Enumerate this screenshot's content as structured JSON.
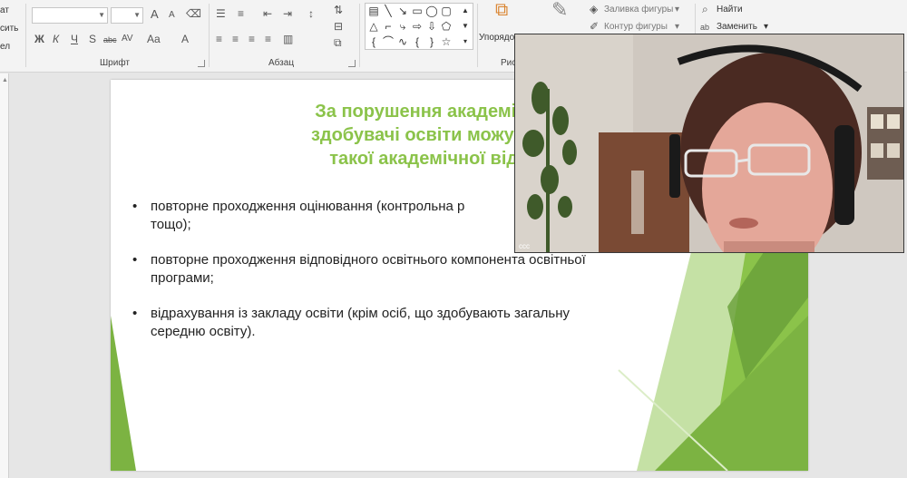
{
  "ribbon": {
    "left_edge": [
      "ат",
      "сить",
      "ел"
    ],
    "font_group_label": "Шрифт",
    "paragraph_group_label": "Абзац",
    "drawing_group_label_partial": "Рис",
    "arrange_label_partial": "Упорядо",
    "shape_fill_label": "Заливка фигуры",
    "shape_outline_label": "Контур фигуры",
    "find_label": "Найти",
    "replace_label": "Заменить",
    "font_buttons": [
      "Ж",
      "К",
      "Ч",
      "S",
      "abc",
      "AV",
      "Aa",
      "A"
    ],
    "font_size_buttons": [
      "A",
      "A"
    ]
  },
  "slide": {
    "title_lines": [
      "За порушення академічної добр",
      "здобувачі освіти можуть бути пр",
      "такої  академічної відповідал"
    ],
    "bullets": [
      [
        "повторне проходження оцінювання (контрольна р",
        "тощо);"
      ],
      [
        "повторне проходження відповідного освітнього компонента освітньої",
        "програми;"
      ],
      [
        "відрахування із закладу освіти (крім осіб, що здобувають загальну",
        "середню освіту)."
      ]
    ]
  },
  "video": {
    "participant_label": "ссс"
  },
  "colors": {
    "accent_green": "#8bc34a",
    "ribbon_bg": "#f3f3f3",
    "workspace_bg": "#e6e6e6"
  }
}
